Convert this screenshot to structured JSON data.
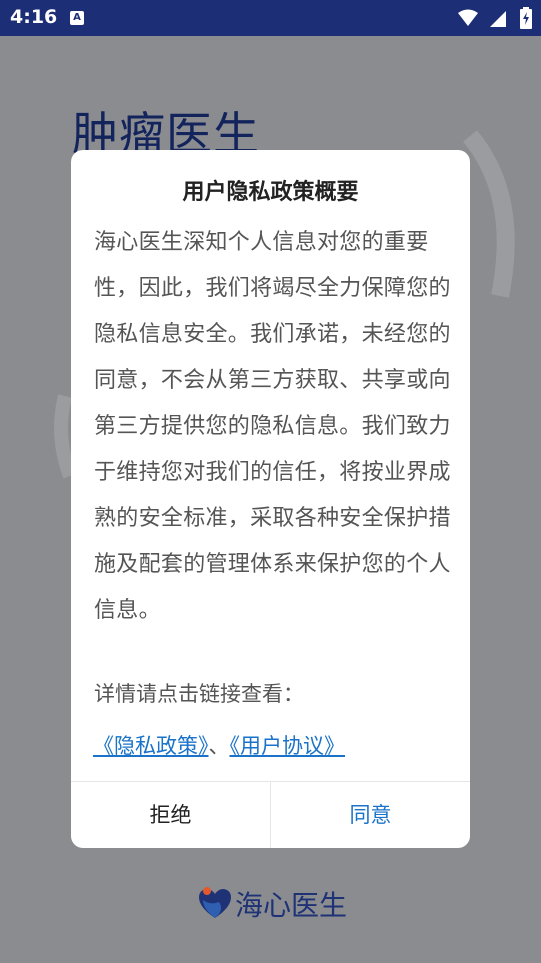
{
  "status_bar": {
    "time": "4:16",
    "notification_icon_letter": "A"
  },
  "app": {
    "title": "肿瘤医生"
  },
  "dialog": {
    "title": "用户隐私政策概要",
    "body": "海心医生深知个人信息对您的重要性，因此，我们将竭尽全力保障您的隐私信息安全。我们承诺，未经您的同意，不会从第三方获取、共享或向第三方提供您的隐私信息。我们致力于维持您对我们的信任，将按业界成熟的安全标准，采取各种安全保护措施及配套的管理体系来保护您的个人信息。",
    "detail_prompt": "详情请点击链接查看：",
    "privacy_link": "《隐私政策》",
    "separator": "、",
    "user_agreement_link": "《用户协议》",
    "reject_label": "拒绝",
    "agree_label": "同意"
  },
  "footer": {
    "brand": "海心医生"
  },
  "colors": {
    "status_bar": "#1c2f76",
    "overlay": "#8a8c90",
    "link": "#1a73c8",
    "brand_dark": "#1e3275"
  }
}
